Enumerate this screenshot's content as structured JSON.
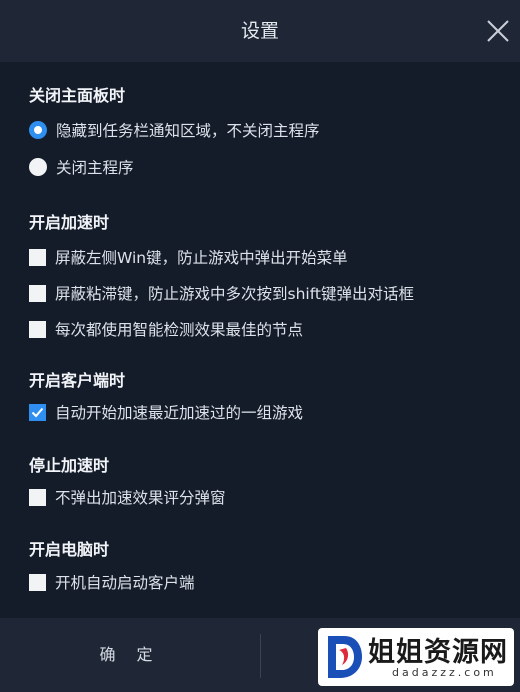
{
  "window": {
    "title": "设置"
  },
  "sections": [
    {
      "title": "关闭主面板时",
      "options": [
        {
          "type": "radio",
          "label": "隐藏到任务栏通知区域，不关闭主程序",
          "checked": true
        },
        {
          "type": "radio",
          "label": "关闭主程序",
          "checked": false
        }
      ]
    },
    {
      "title": "开启加速时",
      "options": [
        {
          "type": "checkbox",
          "label": "屏蔽左侧Win键，防止游戏中弹出开始菜单",
          "checked": false
        },
        {
          "type": "checkbox",
          "label": "屏蔽粘滞键，防止游戏中多次按到shift键弹出对话框",
          "checked": false
        },
        {
          "type": "checkbox",
          "label": "每次都使用智能检测效果最佳的节点",
          "checked": false
        }
      ]
    },
    {
      "title": "开启客户端时",
      "options": [
        {
          "type": "checkbox",
          "label": "自动开始加速最近加速过的一组游戏",
          "checked": true
        }
      ]
    },
    {
      "title": "停止加速时",
      "options": [
        {
          "type": "checkbox",
          "label": "不弹出加速效果评分弹窗",
          "checked": false
        }
      ]
    },
    {
      "title": "开启电脑时",
      "options": [
        {
          "type": "checkbox",
          "label": "开机自动启动客户端",
          "checked": false
        }
      ]
    }
  ],
  "footer": {
    "ok_label": "确 定"
  },
  "watermark": {
    "text": "姐姐资源网",
    "sub": "dadazzz.com"
  },
  "colors": {
    "accent": "#2f8ff0",
    "background": "#141c2a",
    "bar": "#1f2736"
  }
}
